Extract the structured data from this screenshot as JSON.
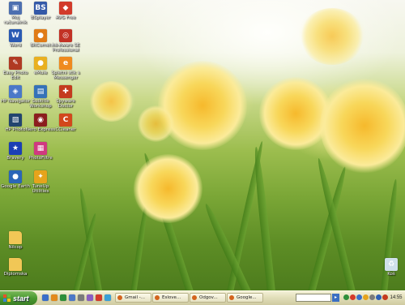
{
  "desktop": {
    "icons": [
      {
        "label": "Moj računalnik",
        "name": "my-computer-icon",
        "color": "#4d6fb0",
        "glyph": "▣"
      },
      {
        "label": "BSplayer",
        "name": "bsplayer-icon",
        "color": "#3459a8",
        "glyph": "BS"
      },
      {
        "label": "AVG Free",
        "name": "avg-free-icon",
        "color": "#d23a2a",
        "glyph": "◆"
      },
      {
        "label": "Word",
        "name": "word-icon",
        "color": "#2a5ab3",
        "glyph": "W"
      },
      {
        "label": "BitComet",
        "name": "bitcomet-icon",
        "color": "#e07b16",
        "glyph": "●"
      },
      {
        "label": "Ad-Aware SE Professional",
        "name": "ad-aware-icon",
        "color": "#c23225",
        "glyph": "◎"
      },
      {
        "label": "Easy Photo Edit",
        "name": "easy-photo-icon",
        "color": "#b03a22",
        "glyph": "✎"
      },
      {
        "label": "eMule",
        "name": "emule-icon",
        "color": "#e9b020",
        "glyph": "●"
      },
      {
        "label": "Spletni stik s Messenger",
        "name": "messenger-icon",
        "color": "#ef8a1e",
        "glyph": "e"
      },
      {
        "label": "HP Navigator",
        "name": "hp-navigator-icon",
        "color": "#4a78c8",
        "glyph": "◈"
      },
      {
        "label": "Subtitle Workshop",
        "name": "subtitle-workshop-icon",
        "color": "#3572b8",
        "glyph": "▤"
      },
      {
        "label": "Spyware Doctor",
        "name": "spyware-doctor-icon",
        "color": "#c43a1e",
        "glyph": "✚"
      },
      {
        "label": "HP Photo",
        "name": "hp-photo-icon",
        "color": "#22446f",
        "glyph": "▧"
      },
      {
        "label": "Nero Express",
        "name": "nero-express-icon",
        "color": "#8b1e1e",
        "glyph": "◉"
      },
      {
        "label": "CCleaner",
        "name": "ccleaner-icon",
        "color": "#d2481c",
        "glyph": "C"
      },
      {
        "label": "Bravery",
        "name": "bravery-icon",
        "color": "#1b3fb5",
        "glyph": "★"
      },
      {
        "label": "PhotoFiltre",
        "name": "photofiltre-icon",
        "color": "#d03a80",
        "glyph": "▦"
      },
      {
        "label": "Google Earth",
        "name": "google-earth-icon",
        "color": "#2b66b8",
        "glyph": "●"
      },
      {
        "label": "TuneUp Utilities",
        "name": "tuneup-icon",
        "color": "#e6a41c",
        "glyph": "✦"
      },
      {
        "label": "Nilcop",
        "name": "folder-nilcop-icon",
        "color": "#f1c756",
        "glyph": ""
      },
      {
        "label": "Diplomska",
        "name": "folder-diplomska-icon",
        "color": "#f1c756",
        "glyph": ""
      },
      {
        "label": "Koš",
        "name": "recycle-bin-icon",
        "color": "#cfe0ea",
        "glyph": "♻"
      }
    ]
  },
  "taskbar": {
    "start_label": "start",
    "quick_launch": [
      "#3a6fc9",
      "#e38a1c",
      "#2e8f3a",
      "#4d79c7",
      "#7b7b7b",
      "#8a5fc1",
      "#d43b2a",
      "#3aa0d8"
    ],
    "tasks": [
      {
        "label": "Gmail -..."
      },
      {
        "label": "Eslove..."
      },
      {
        "label": "Odgov..."
      },
      {
        "label": "Google..."
      }
    ],
    "tray_colors": [
      "#2e8f3a",
      "#d43b2a",
      "#3a6fc9",
      "#e6a41c",
      "#7b7b7b",
      "#2e5fb5",
      "#c43a1e"
    ],
    "clock": "14:55"
  }
}
